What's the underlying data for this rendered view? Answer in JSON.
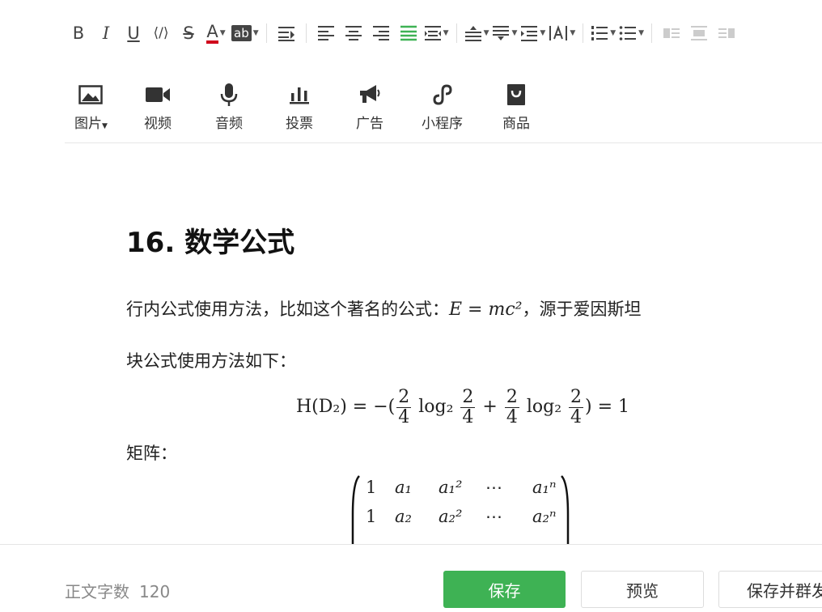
{
  "toolbar": {
    "bold": "B",
    "italic": "I",
    "underline": "U",
    "code": "⟨/⟩",
    "strike": "S",
    "font_color": "A",
    "highlight": "ab",
    "font_color_hex": "#d0021b",
    "active_align_hex": "#3eb254"
  },
  "insert": {
    "image_label": "图片",
    "video_label": "视频",
    "audio_label": "音频",
    "vote_label": "投票",
    "ad_label": "广告",
    "miniprogram_label": "小程序",
    "product_label": "商品"
  },
  "article": {
    "heading": "16. 数学公式",
    "inline_text_before": "行内公式使用方法，比如这个著名的公式：",
    "inline_formula": "E = mc²",
    "inline_text_after": "，源于爱因斯坦",
    "block_intro": "块公式使用方法如下：",
    "block_formula": "H(D₂) = −(2/4 log₂ 2/4 + 2/4 log₂ 2/4) = 1",
    "matrix_label": "矩阵：",
    "matrix_rows": [
      [
        "1",
        "a₁",
        "a₁²",
        "⋯",
        "a₁ⁿ"
      ],
      [
        "1",
        "a₂",
        "a₂²",
        "⋯",
        "a₂ⁿ"
      ]
    ]
  },
  "footer": {
    "word_count_label": "正文字数",
    "word_count_value": "120",
    "save_label": "保存",
    "preview_label": "预览",
    "publish_label": "保存并群发"
  }
}
